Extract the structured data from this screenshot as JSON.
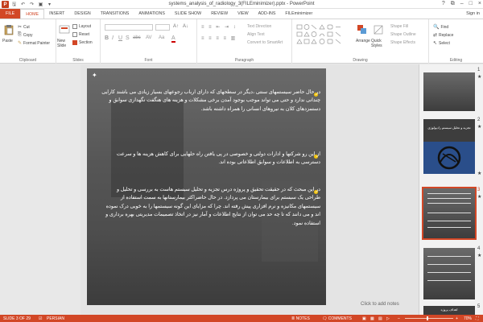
{
  "window": {
    "title": "systems_analysis_of_radiology_3(FILEminimizer).pptx - PowerPoint",
    "sign_in": "Sign in",
    "ctrl_help": "?",
    "ctrl_restore": "⧉",
    "ctrl_minimize": "–",
    "ctrl_maximize": "□",
    "ctrl_close": "×"
  },
  "tabs": [
    "FILE",
    "HOME",
    "INSERT",
    "DESIGN",
    "TRANSITIONS",
    "ANIMATIONS",
    "SLIDE SHOW",
    "REVIEW",
    "VIEW",
    "ADD-INS",
    "FILEminimizer"
  ],
  "ribbon": {
    "clipboard": {
      "label": "Clipboard",
      "paste": "Paste",
      "cut": "Cut",
      "copy": "Copy",
      "format_painter": "Format Painter"
    },
    "slides": {
      "label": "Slides",
      "new_slide": "New Slide",
      "layout": "Layout",
      "reset": "Reset",
      "section": "Section"
    },
    "font": {
      "label": "Font"
    },
    "paragraph": {
      "label": "Paragraph",
      "text_direction": "Text Direction",
      "align_text": "Align Text",
      "convert_smartart": "Convert to SmartArt"
    },
    "drawing": {
      "label": "Drawing",
      "arrange": "Arrange",
      "quick_styles": "Quick Styles",
      "shape_fill": "Shape Fill",
      "shape_outline": "Shape Outline",
      "shape_effects": "Shape Effects"
    },
    "editing": {
      "label": "Editing",
      "find": "Find",
      "replace": "Replace",
      "select": "Select"
    }
  },
  "slide": {
    "para1": "در حال حاضر سیستمهای سنتی ،دیگر در سطحهای که دارای ارباب رجوعهای بسیار زیادی می باشند کارایی چندانی ندارد و حتی می تواند موجب بوجود آمدن برخی مشکلات و هزینه های هنگفت نگهداری سوابق و دستمزدهای کلان به نیروهای انسانی را همراه داشته باشد.",
    "para2": "از این رو شرکتها و ادارات دولتی و خصوصی در پی یافتن راه حلهایی برای کاهش هزینه ها و سرعت دسترسی به اطلاعات و سوابق اطلاعاتی بوده اند.",
    "para3": "در این مبحث که در حقیقت تحقیق و پروژه درس تجزیه و تحلیل سیستم هاست به بررسی و تحلیل و طراحی یک سیستم برای بیمارستان می پردازد. در حال حاضراکثر بیمارستانها به سمت استفاده از سیستمهای مکانیزه و نرم افزاری پیش رفته اند. چرا که مزایای این گونه سیستمها را به خوبی درک نموده اند و می دانند که تا چه حد می توان از نتایج اطلاعات و آمار نیز در اتخاذ تصمیمات مدیریتی بهره برداری و استفاده نمود."
  },
  "thumbnails": [
    {
      "num": "1",
      "title": ""
    },
    {
      "num": "2",
      "title": "تجزیه و تحلیل سیستم رادیولوژی"
    },
    {
      "num": "3",
      "title": ""
    },
    {
      "num": "4",
      "title": ""
    },
    {
      "num": "5",
      "title": "اهداف پروژه"
    }
  ],
  "notes": {
    "placeholder": "Click to add notes"
  },
  "status": {
    "slide_info": "SLIDE 3 OF 29",
    "language": "PERSIAN",
    "notes": "NOTES",
    "comments": "COMMENTS",
    "zoom": "70%"
  },
  "colors": {
    "accent": "#d24726",
    "bullet": "#f2c40f"
  }
}
